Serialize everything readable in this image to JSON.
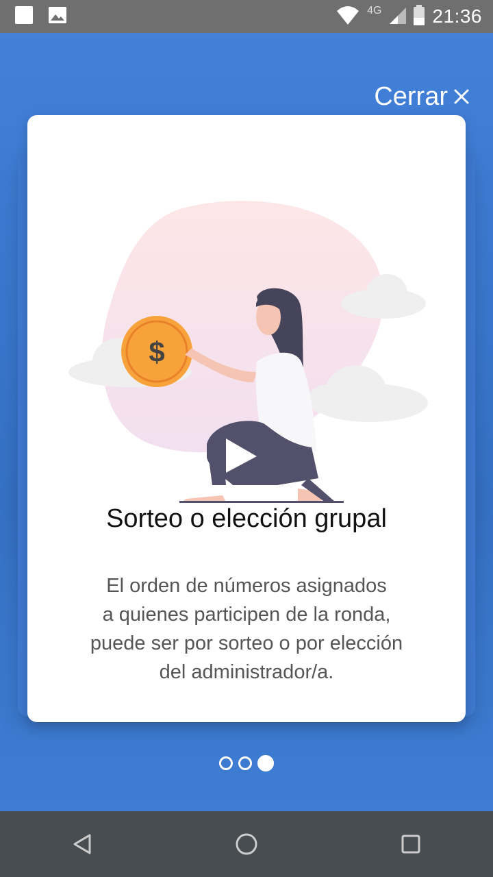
{
  "status_bar": {
    "time": "21:36",
    "network": "4G",
    "icons": [
      "notification-square-icon",
      "image-icon",
      "wifi-icon",
      "signal-icon",
      "battery-icon"
    ]
  },
  "header": {
    "close_label": "Cerrar",
    "close_icon": "close-icon"
  },
  "slide": {
    "title": "Sorteo o elección grupal",
    "description_lines": [
      "El orden de números asignados",
      "a quienes participen de la ronda,",
      "puede ser por sorteo o por elección",
      "del administrador/a."
    ],
    "illustration": "woman-holding-coin-illustration",
    "coin_symbol": "$"
  },
  "pager": {
    "total": 3,
    "active_index": 2
  },
  "nav_bar": {
    "buttons": [
      "back-icon",
      "home-icon",
      "recents-icon"
    ]
  },
  "colors": {
    "background": "#3f7fd6",
    "card": "#ffffff",
    "accent_coin": "#f7a23a",
    "nav_bar": "#484d52",
    "status_bar": "#6f6f6f"
  }
}
